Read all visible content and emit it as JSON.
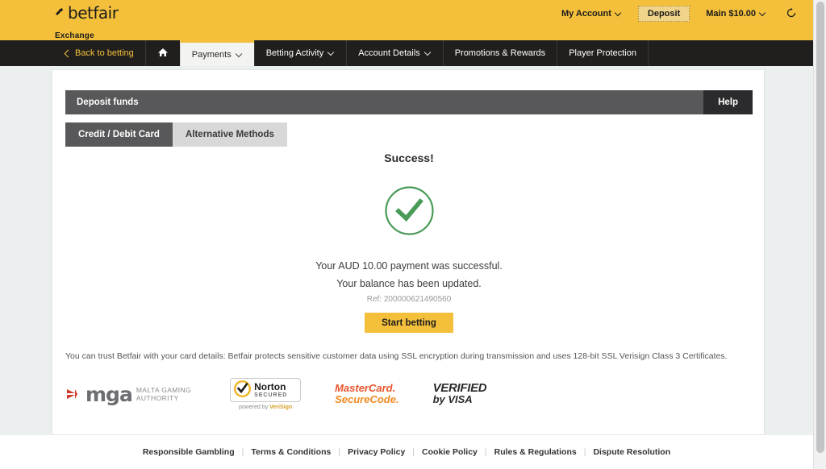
{
  "header": {
    "brand": "betfair",
    "brand_sub": "Exchange",
    "my_account": "My Account",
    "deposit_button": "Deposit",
    "balance": "Main $10.00",
    "refresh_icon": "refresh-icon",
    "gold": "#f4c03c"
  },
  "nav": {
    "back": "Back to betting",
    "home_icon": "home-icon",
    "items": [
      {
        "label": "Payments",
        "caret": true,
        "active": true
      },
      {
        "label": "Betting Activity",
        "caret": true,
        "active": false
      },
      {
        "label": "Account Details",
        "caret": true,
        "active": false
      },
      {
        "label": "Promotions & Rewards",
        "caret": false,
        "active": false
      },
      {
        "label": "Player Protection",
        "caret": false,
        "active": false
      }
    ]
  },
  "panel": {
    "title": "Deposit funds",
    "help": "Help",
    "tabs": [
      {
        "label": "Credit / Debit Card",
        "active": true
      },
      {
        "label": "Alternative Methods",
        "active": false
      }
    ]
  },
  "success": {
    "title": "Success!",
    "icon": "check-circle-icon",
    "check_color": "#4a9a58",
    "message_line1": "Your AUD 10.00 payment was successful.",
    "message_line2": "Your balance has been updated.",
    "reference": "Ref: 200000621490560",
    "start_button": "Start betting"
  },
  "trust": {
    "text": "You can trust Betfair with your card details: Betfair protects sensitive customer data using SSL encryption during transmission and uses 128-bit SSL Verisign Class 3 Certificates."
  },
  "logos": {
    "mga_word": "mga",
    "mga_line1": "MALTA GAMING",
    "mga_line2": "AUTHORITY",
    "norton_name": "Norton",
    "norton_secured": "SECURED",
    "norton_powered_pre": "powered by ",
    "norton_powered_brand": "VeriSign",
    "mastercard_line1": "MasterCard.",
    "mastercard_line2": "SecureCode.",
    "visa_line1": "VERIFIED",
    "visa_line2": "by VISA"
  },
  "footer": {
    "links": [
      "Responsible Gambling",
      "Terms & Conditions",
      "Privacy Policy",
      "Cookie Policy",
      "Rules & Regulations",
      "Dispute Resolution"
    ]
  }
}
